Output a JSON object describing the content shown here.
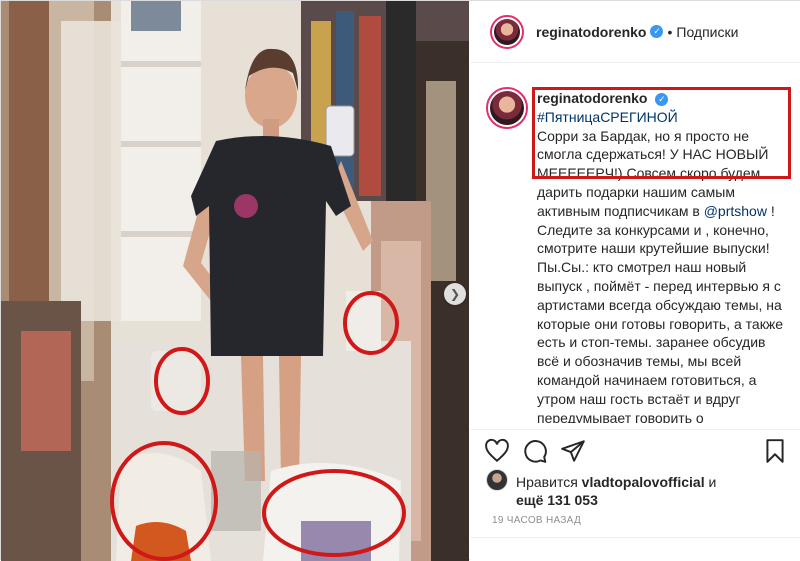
{
  "header": {
    "username": "reginatodorenko",
    "separator": "•",
    "follow_label": "Подписки"
  },
  "caption": {
    "username": "reginatodorenko",
    "hashtag": "#ПятницаСРЕГИНОЙ",
    "text_1": "Сорри за Бардак, но я просто не смогла сдержаться! У НАС НОВЫЙ МЕЕЕЕЕРЧ!) Совсем скоро будем дарить подарки нашим самым активным подписчикам в ",
    "mention": "@prtshow",
    "text_2": " ! Следите за конкурсами и , конечно, смотрите наши крутейшие выпуски! Пы.Сы.: кто смотрел наш новый выпуск , поймёт - перед интервью я с артистами всегда обсуждаю темы, на которые они готовы говорить, а также есть и стоп-темы. заранее обсудив всё и обозначив темы, мы всей командой начинаем готовиться, а утром наш гость встаёт и вдруг передумывает говорить о"
  },
  "likes": {
    "prefix": "Нравится ",
    "user": "vladtopalovofficial",
    "and": " и",
    "count": "ещё 131 053"
  },
  "timestamp": "19 ЧАСОВ НАЗАД",
  "icons": {
    "heart": "heart-icon",
    "comment": "comment-icon",
    "share": "share-icon",
    "save": "bookmark-icon",
    "verified": "verified-badge-icon"
  },
  "colors": {
    "verified": "#3897f0",
    "highlight": "#d11818",
    "link": "#003569",
    "story_ring": "#e1306c"
  }
}
